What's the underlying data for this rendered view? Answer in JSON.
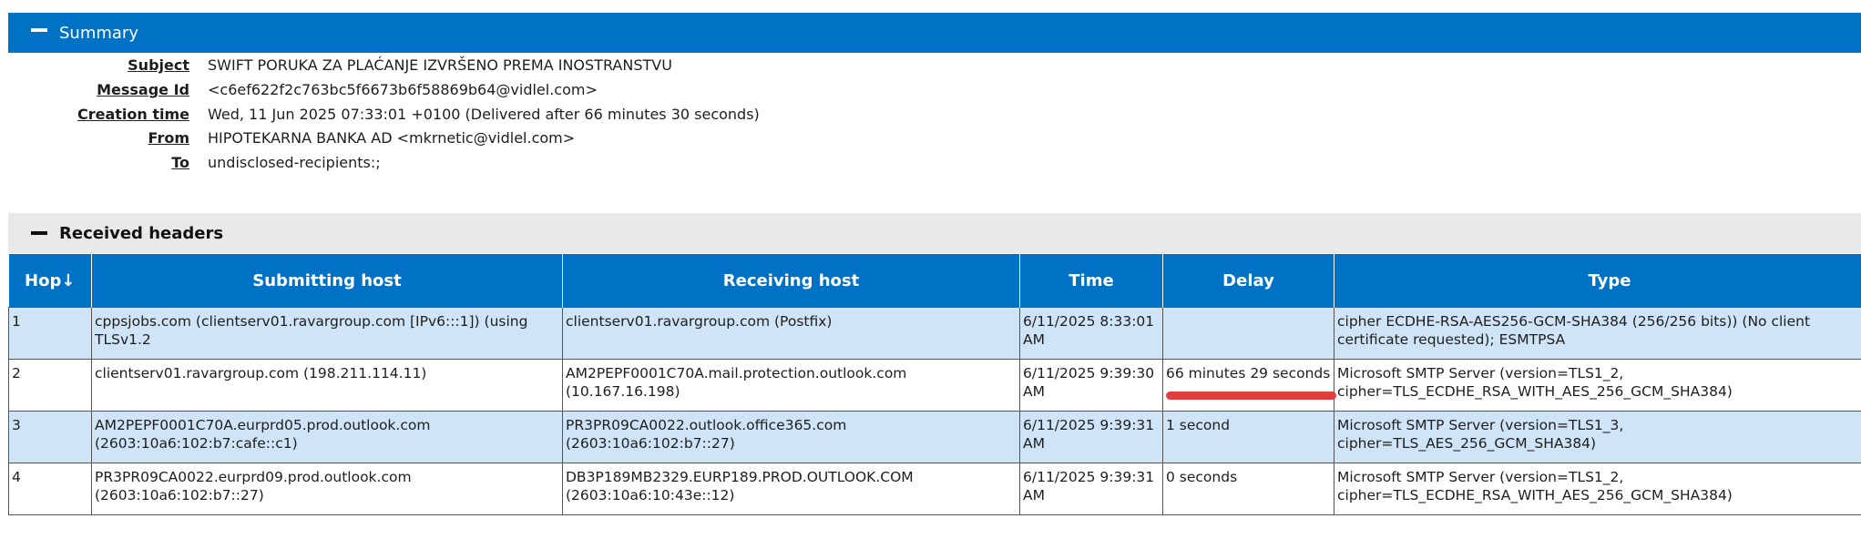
{
  "summary": {
    "title": "Summary",
    "rows": [
      {
        "label": "Subject",
        "value": "SWIFT PORUKA ZA PLAĆANJE IZVRŠENO PREMA INOSTRANSTVU"
      },
      {
        "label": "Message Id",
        "value": "<c6ef622f2c763bc5f6673b6f58869b64@vidlel.com>"
      },
      {
        "label": "Creation time",
        "value": "Wed, 11 Jun 2025 07:33:01 +0100 (Delivered after 66 minutes 30 seconds)"
      },
      {
        "label": "From",
        "value": "HIPOTEKARNA BANKA AD <mkrnetic@vidlel.com>"
      },
      {
        "label": "To",
        "value": "undisclosed-recipients:;"
      }
    ]
  },
  "received": {
    "title": "Received headers",
    "columns": {
      "hop": "Hop↓",
      "submitting": "Submitting host",
      "receiving": "Receiving host",
      "time": "Time",
      "delay": "Delay",
      "type": "Type"
    },
    "rows": [
      {
        "hop": "1",
        "submitting": "cppsjobs.com (clientserv01.ravargroup.com [IPv6:::1]) (using TLSv1.2",
        "receiving": "clientserv01.ravargroup.com (Postfix)",
        "time": "6/11/2025 8:33:01 AM",
        "delay": "",
        "type": "cipher ECDHE-RSA-AES256-GCM-SHA384 (256/256 bits)) (No client certificate requested); ESMTPSA"
      },
      {
        "hop": "2",
        "submitting": "clientserv01.ravargroup.com (198.211.114.11)",
        "receiving": "AM2PEPF0001C70A.mail.protection.outlook.com (10.167.16.198)",
        "time": "6/11/2025 9:39:30 AM",
        "delay": "66 minutes 29 seconds",
        "type": "Microsoft SMTP Server (version=TLS1_2, cipher=TLS_ECDHE_RSA_WITH_AES_256_GCM_SHA384)"
      },
      {
        "hop": "3",
        "submitting": "AM2PEPF0001C70A.eurprd05.prod.outlook.com (2603:10a6:102:b7:cafe::c1)",
        "receiving": "PR3PR09CA0022.outlook.office365.com (2603:10a6:102:b7::27)",
        "time": "6/11/2025 9:39:31 AM",
        "delay": "1 second",
        "type": "Microsoft SMTP Server (version=TLS1_3, cipher=TLS_AES_256_GCM_SHA384)"
      },
      {
        "hop": "4",
        "submitting": "PR3PR09CA0022.eurprd09.prod.outlook.com (2603:10a6:102:b7::27)",
        "receiving": "DB3P189MB2329.EURP189.PROD.OUTLOOK.COM (2603:10a6:10:43e::12)",
        "time": "6/11/2025 9:39:31 AM",
        "delay": "0 seconds",
        "type": "Microsoft SMTP Server (version=TLS1_2, cipher=TLS_ECDHE_RSA_WITH_AES_256_GCM_SHA384)"
      }
    ]
  },
  "colors": {
    "header_blue": "#0072c6",
    "row_alt": "#cfe4f7",
    "annotation_red": "#e0403d"
  }
}
